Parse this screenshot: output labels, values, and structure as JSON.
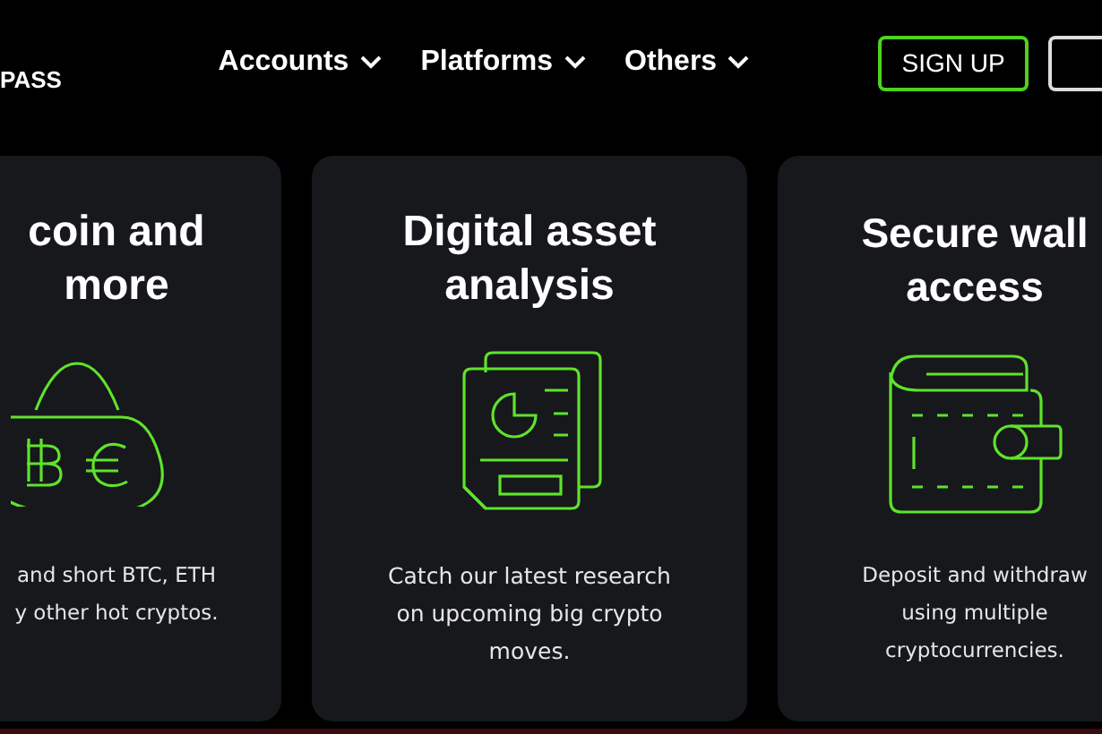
{
  "header": {
    "logo": "PASS",
    "nav": [
      {
        "label": "Accounts",
        "expanded": false
      },
      {
        "label": "Platforms",
        "expanded": false
      },
      {
        "label": "Others",
        "expanded": false
      }
    ],
    "signup_button": "SIGN UP"
  },
  "cards": [
    {
      "title": [
        "coin and",
        "more"
      ],
      "text": [
        "and short BTC, ETH",
        "y other hot cryptos."
      ]
    },
    {
      "title": [
        "Digital asset",
        "analysis"
      ],
      "text": [
        "Catch our latest research",
        "on upcoming big crypto",
        "moves."
      ]
    },
    {
      "title": [
        "Secure wall",
        "access"
      ],
      "text": [
        "Deposit and withdraw",
        "using multiple",
        "cryptocurrencies."
      ]
    }
  ]
}
